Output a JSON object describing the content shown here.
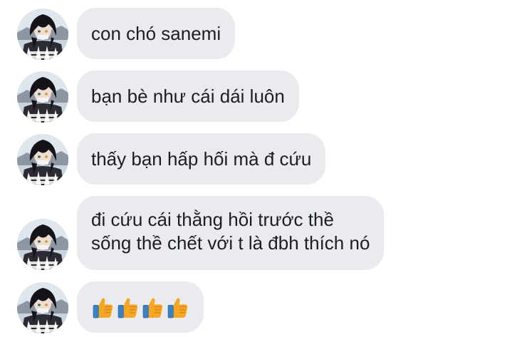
{
  "messages": [
    {
      "type": "text",
      "lines": [
        "con chó sanemi"
      ]
    },
    {
      "type": "text",
      "lines": [
        "bạn bè như cái dái luôn"
      ]
    },
    {
      "type": "text",
      "lines": [
        "thấy bạn hấp hối mà đ cứu"
      ]
    },
    {
      "type": "text",
      "lines": [
        "đi cứu cái thằng hồi trước thề",
        "sống thề chết với t là đbh thích nó"
      ]
    },
    {
      "type": "reaction",
      "icons": [
        "thumbs-up-icon",
        "thumbs-up-icon",
        "thumbs-up-icon",
        "thumbs-up-icon"
      ]
    }
  ],
  "colors": {
    "bubble": "#e9ebef",
    "text": "#1c1e21",
    "thumb": "#f5a623"
  }
}
